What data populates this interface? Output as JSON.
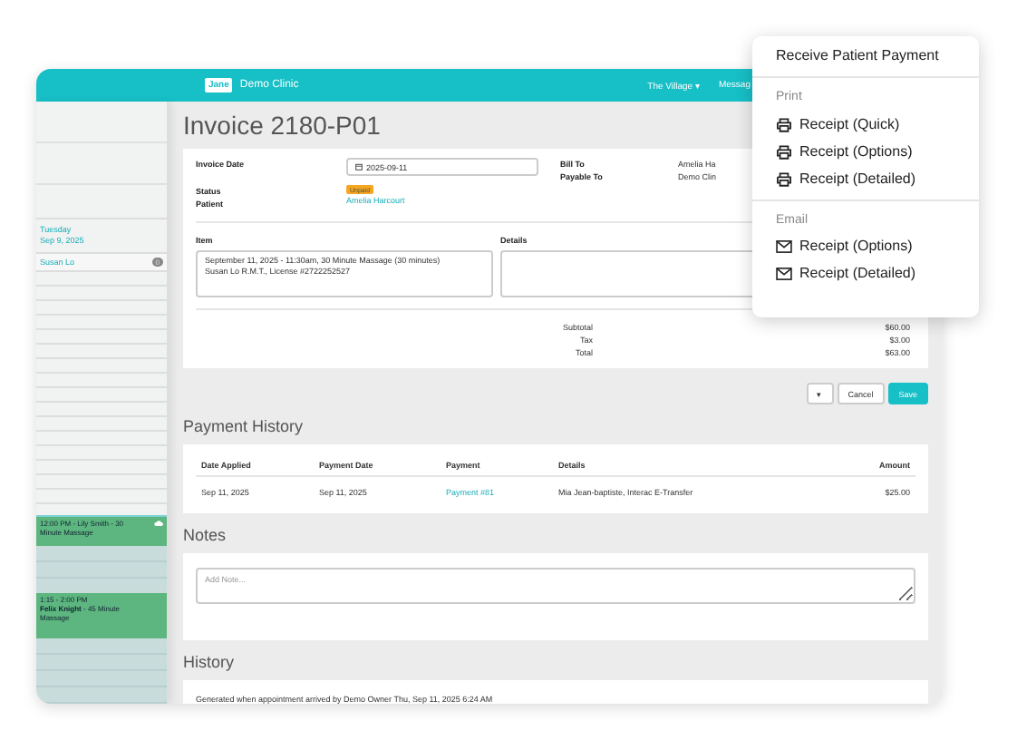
{
  "header": {
    "logo": "Jane",
    "clinic_name": "Demo Clinic",
    "location": "The Village ▾",
    "nav_item": "Messag"
  },
  "calendar": {
    "day": "Tuesday",
    "date": "Sep 9, 2025",
    "provider": "Susan Lo",
    "provider_count": "0",
    "appointments": [
      {
        "time": "12:00 PM - Lily Smith - 30 Minute Massage",
        "kind": "cloud"
      },
      {
        "time": "1:15 - 2:00 PM",
        "detail": "**Felix Knight** - 45 Minute Massage",
        "kind": "plain"
      }
    ]
  },
  "invoice": {
    "title": "Invoice 2180-P01",
    "invoice_date_label": "Invoice Date",
    "invoice_date": "2025-09-11",
    "status_label": "Status",
    "status": "Unpaid",
    "patient_label": "Patient",
    "patient": "Amelia Harcourt",
    "bill_to_label": "Bill To",
    "bill_to": "Amelia Ha",
    "payable_to_label": "Payable To",
    "payable_to": "Demo Clin",
    "item_label": "Item",
    "item_text": "September 11, 2025 - 11:30am, 30 Minute Massage (30 minutes)\nSusan Lo R.M.T., License #2722252527",
    "details_label": "Details",
    "totals": [
      {
        "label": "Subtotal",
        "value": "$60.00"
      },
      {
        "label": "Tax",
        "value": "$3.00"
      },
      {
        "label": "Total",
        "value": "$63.00"
      }
    ],
    "caret": "▾",
    "cancel": "Cancel",
    "save": "Save"
  },
  "payment_history": {
    "heading": "Payment History",
    "columns": [
      "Date Applied",
      "Payment Date",
      "Payment",
      "Details",
      "Amount"
    ],
    "rows": [
      {
        "date_applied": "Sep 11, 2025",
        "payment_date": "Sep 11, 2025",
        "payment": "Payment #81",
        "details": "Mia Jean-baptiste, Interac E-Transfer",
        "amount": "$25.00"
      }
    ]
  },
  "notes": {
    "heading": "Notes",
    "placeholder": "Add Note..."
  },
  "history": {
    "heading": "History",
    "entries": [
      "Generated when appointment arrived by Demo Owner Thu, Sep 11, 2025 6:24 AM"
    ]
  },
  "menu": {
    "title": "Receive Patient Payment",
    "sections": [
      {
        "label": "Print",
        "items": [
          {
            "label": "Receipt (Quick)",
            "kind": "printer"
          },
          {
            "label": "Receipt (Options)",
            "kind": "printer"
          },
          {
            "label": "Receipt (Detailed)",
            "kind": "printer"
          }
        ]
      },
      {
        "label": "Email",
        "items": [
          {
            "label": "Receipt (Options)",
            "kind": "envelope"
          },
          {
            "label": "Receipt (Detailed)",
            "kind": "envelope"
          }
        ]
      }
    ]
  }
}
